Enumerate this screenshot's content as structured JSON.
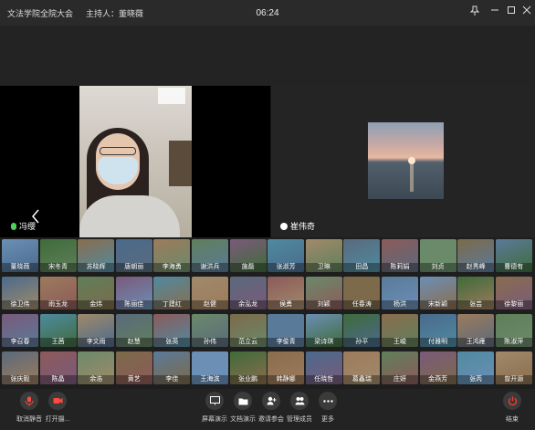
{
  "titlebar": {
    "meeting_title": "文法学院全院大会",
    "host_label": "主持人：董晓薇",
    "clock": "06:24",
    "icons": [
      "pin-icon",
      "minimize-icon",
      "maximize-icon",
      "close-icon"
    ]
  },
  "main": {
    "left_name": "冯缨",
    "right_name": "崔伟奇"
  },
  "participants": [
    [
      "董晓薇",
      "宋冬青",
      "苏晓辉",
      "唐朝丽",
      "李海勇",
      "谢洪兵",
      "施磊",
      "张淑芳",
      "卫琳",
      "田昌",
      "陈莉娟",
      "刘贞",
      "赵秀峰",
      "曹德有"
    ],
    [
      "徐卫伟",
      "雨玉龙",
      "金炜",
      "陈丽佳",
      "丁建红",
      "赵健",
      "余泓龙",
      "侯勇",
      "刘颖",
      "任春涛",
      "杨洪",
      "宋新颖",
      "张芸",
      "徐黎丽"
    ],
    [
      "李召春",
      "王茜",
      "李文雨",
      "赵慧",
      "张英",
      "孙伟",
      "范立云",
      "李俊青",
      "梁诗琪",
      "孙平",
      "王峻",
      "付雅明",
      "王鸿雁",
      "陈淑萍"
    ],
    [
      "张庆毅",
      "陈晶",
      "余浩",
      "黄艺",
      "李佳",
      "王海滨",
      "张业鹏",
      "韩静娜",
      "任晓哲",
      "葛鑫瑞",
      "庄妍",
      "金燕芳",
      "张芮",
      "曾开源"
    ]
  ],
  "toolbar": {
    "mute_label": "取消静音",
    "camera_label": "打开摄...",
    "share_screen_label": "屏幕演示",
    "share_doc_label": "文档演示",
    "invite_label": "邀请参会",
    "members_label": "管理成员",
    "more_label": "更多",
    "end_label": "结束"
  }
}
